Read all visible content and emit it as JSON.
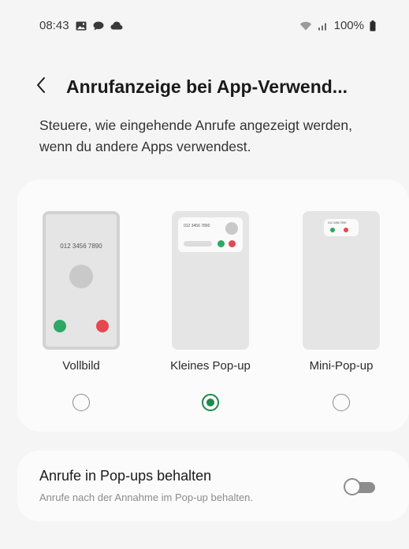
{
  "status_bar": {
    "time": "08:43",
    "battery": "100%",
    "left_icons": [
      "gallery-icon",
      "chat-icon",
      "cloud-icon"
    ],
    "right_icons": [
      "wifi-icon",
      "signal-icon",
      "battery-icon"
    ]
  },
  "header": {
    "title": "Anrufanzeige bei App-Verwend...",
    "back_icon": "chevron-left-icon"
  },
  "description": "Steuere, wie eingehende Anrufe angezeigt werden, wenn du andere Apps verwendest.",
  "options": [
    {
      "label": "Vollbild",
      "preview_number": "012 3456 7890",
      "selected": false
    },
    {
      "label": "Kleines Pop-up",
      "preview_number": "012 3456 7890",
      "selected": true
    },
    {
      "label": "Mini-Pop-up",
      "preview_number": "012 3456 7890",
      "selected": false
    }
  ],
  "setting": {
    "title": "Anrufe in Pop-ups behalten",
    "subtitle": "Anrufe nach der Annahme im Pop-up behalten.",
    "enabled": false
  },
  "colors": {
    "accent": "#1d8a4c",
    "accept": "#2ea865",
    "decline": "#e5484d",
    "background": "#f5f5f5",
    "card": "#fbfbfb"
  }
}
